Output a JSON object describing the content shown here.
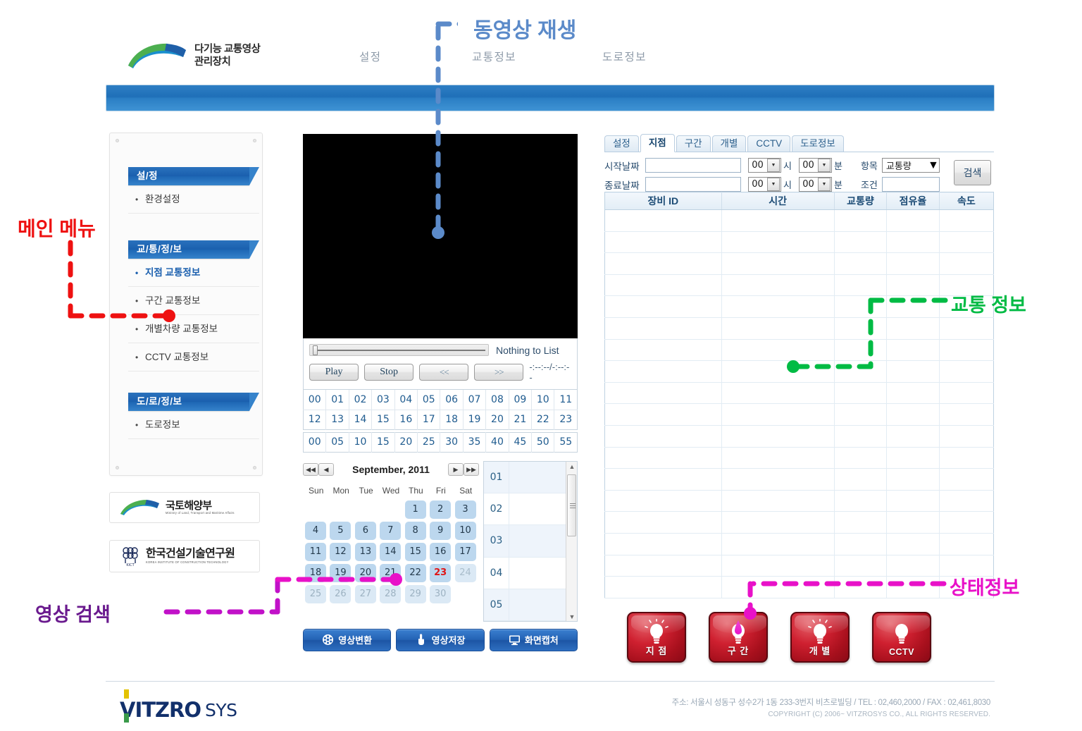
{
  "header": {
    "brand_line1": "다기능 교통영상",
    "brand_line2": "관리장치",
    "nav": [
      {
        "label": "설정"
      },
      {
        "label": "교통정보"
      },
      {
        "label": "도로정보"
      }
    ]
  },
  "sidebar": {
    "groups": [
      {
        "title": "설/정",
        "items": [
          {
            "label": "환경설정",
            "active": false
          }
        ]
      },
      {
        "title": "교/통/정/보",
        "items": [
          {
            "label": "지점 교통정보",
            "active": true
          },
          {
            "label": "구간 교통정보",
            "active": false
          },
          {
            "label": "개별차량 교통정보",
            "active": false
          },
          {
            "label": "CCTV 교통정보",
            "active": false
          }
        ]
      },
      {
        "title": "도/로/정/보",
        "items": [
          {
            "label": "도로정보",
            "active": false
          }
        ]
      }
    ],
    "logos": [
      {
        "name_ko": "국토해양부",
        "name_en": "Ministry of Land, Transport and Maritime Affairs"
      },
      {
        "name_ko": "한국건설기술연구원",
        "name_en": "KOREA INSTITUTE OF CONSTRUCTION TECHNOLOGY",
        "mark": "KICT"
      }
    ]
  },
  "video": {
    "status_text": "Nothing to List",
    "timecode": "-:--:--/-:--:--",
    "buttons": {
      "play": "Play",
      "stop": "Stop",
      "prev": "<<",
      "next": ">>"
    },
    "hours_row1": [
      "00",
      "01",
      "02",
      "03",
      "04",
      "05",
      "06",
      "07",
      "08",
      "09",
      "10",
      "11"
    ],
    "hours_row2": [
      "12",
      "13",
      "14",
      "15",
      "16",
      "17",
      "18",
      "19",
      "20",
      "21",
      "22",
      "23"
    ],
    "minutes": [
      "00",
      "05",
      "10",
      "15",
      "20",
      "25",
      "30",
      "35",
      "40",
      "45",
      "50",
      "55"
    ],
    "actions": [
      {
        "label": "영상변환",
        "icon": "film-reel-icon"
      },
      {
        "label": "영상저장",
        "icon": "hand-pointer-icon"
      },
      {
        "label": "화면캡처",
        "icon": "monitor-icon"
      }
    ]
  },
  "calendar": {
    "title": "September, 2011",
    "nav": {
      "first": "◀◀",
      "prev": "◀",
      "next": "▶",
      "last": "▶▶"
    },
    "weekdays": [
      "Sun",
      "Mon",
      "Tue",
      "Wed",
      "Thu",
      "Fri",
      "Sat"
    ],
    "weeks": [
      [
        {
          "d": "",
          "state": "blank"
        },
        {
          "d": "",
          "state": "blank"
        },
        {
          "d": "",
          "state": "blank"
        },
        {
          "d": "",
          "state": "blank"
        },
        {
          "d": "1",
          "state": "normal"
        },
        {
          "d": "2",
          "state": "normal"
        },
        {
          "d": "3",
          "state": "normal"
        }
      ],
      [
        {
          "d": "4",
          "state": "normal"
        },
        {
          "d": "5",
          "state": "normal"
        },
        {
          "d": "6",
          "state": "normal"
        },
        {
          "d": "7",
          "state": "normal"
        },
        {
          "d": "8",
          "state": "normal"
        },
        {
          "d": "9",
          "state": "normal"
        },
        {
          "d": "10",
          "state": "normal"
        }
      ],
      [
        {
          "d": "11",
          "state": "normal"
        },
        {
          "d": "12",
          "state": "normal"
        },
        {
          "d": "13",
          "state": "normal"
        },
        {
          "d": "14",
          "state": "normal"
        },
        {
          "d": "15",
          "state": "normal"
        },
        {
          "d": "16",
          "state": "normal"
        },
        {
          "d": "17",
          "state": "normal"
        }
      ],
      [
        {
          "d": "18",
          "state": "normal"
        },
        {
          "d": "19",
          "state": "normal"
        },
        {
          "d": "20",
          "state": "normal"
        },
        {
          "d": "21",
          "state": "normal"
        },
        {
          "d": "22",
          "state": "normal"
        },
        {
          "d": "23",
          "state": "today"
        },
        {
          "d": "24",
          "state": "disabled"
        }
      ],
      [
        {
          "d": "25",
          "state": "muted"
        },
        {
          "d": "26",
          "state": "muted"
        },
        {
          "d": "27",
          "state": "muted"
        },
        {
          "d": "28",
          "state": "muted"
        },
        {
          "d": "29",
          "state": "muted"
        },
        {
          "d": "30",
          "state": "muted"
        },
        {
          "d": "",
          "state": "blank"
        }
      ]
    ],
    "hour_list": [
      "01",
      "02",
      "03",
      "04",
      "05"
    ]
  },
  "right_panel": {
    "tabs": [
      {
        "label": "설정",
        "active": false
      },
      {
        "label": "지점",
        "active": true
      },
      {
        "label": "구간",
        "active": false
      },
      {
        "label": "개별",
        "active": false
      },
      {
        "label": "CCTV",
        "active": false
      },
      {
        "label": "도로정보",
        "active": false
      }
    ],
    "search": {
      "start_label": "시작날짜",
      "end_label": "종료날짜",
      "start_value": "",
      "end_value": "",
      "start_hour": "00",
      "start_minute": "00",
      "end_hour": "00",
      "end_minute": "00",
      "hour_unit": "시",
      "minute_unit": "분",
      "item_label": "항목",
      "item_value": "교통량",
      "cond_label": "조건",
      "cond_value": "",
      "search_button": "검색"
    },
    "table": {
      "columns": [
        "장비 ID",
        "시간",
        "교통량",
        "점유율",
        "속도"
      ],
      "rows": []
    },
    "lamps": [
      {
        "label": "지 점",
        "lit": false,
        "en": false
      },
      {
        "label": "구 간",
        "lit": true,
        "en": false
      },
      {
        "label": "개 별",
        "lit": false,
        "en": false
      },
      {
        "label": "CCTV",
        "lit": false,
        "en": true
      }
    ]
  },
  "footer": {
    "logo_main": "VITZRO",
    "logo_sub": "SYS",
    "address": "주소: 서울시 성동구 성수2가 1동 233-3번지 비츠로빌딩  /  TEL : 02,460,2000  /  FAX : 02,461,8030",
    "copyright": "COPYRIGHT (C) 2006~ VITZROSYS CO., ALL RIGHTS RESERVED."
  },
  "annotations": [
    {
      "id": "video-playback",
      "text": "동영상 재생",
      "color": "#5b8ac9"
    },
    {
      "id": "main-menu",
      "text": "메인 메뉴",
      "color": "#ee1111"
    },
    {
      "id": "traffic-info",
      "text": "교통 정보",
      "color": "#00bb44"
    },
    {
      "id": "status-info",
      "text": "상태정보",
      "color": "#e811c8"
    },
    {
      "id": "video-search",
      "text": "영상 검색",
      "color": "#6a1a8e"
    }
  ]
}
